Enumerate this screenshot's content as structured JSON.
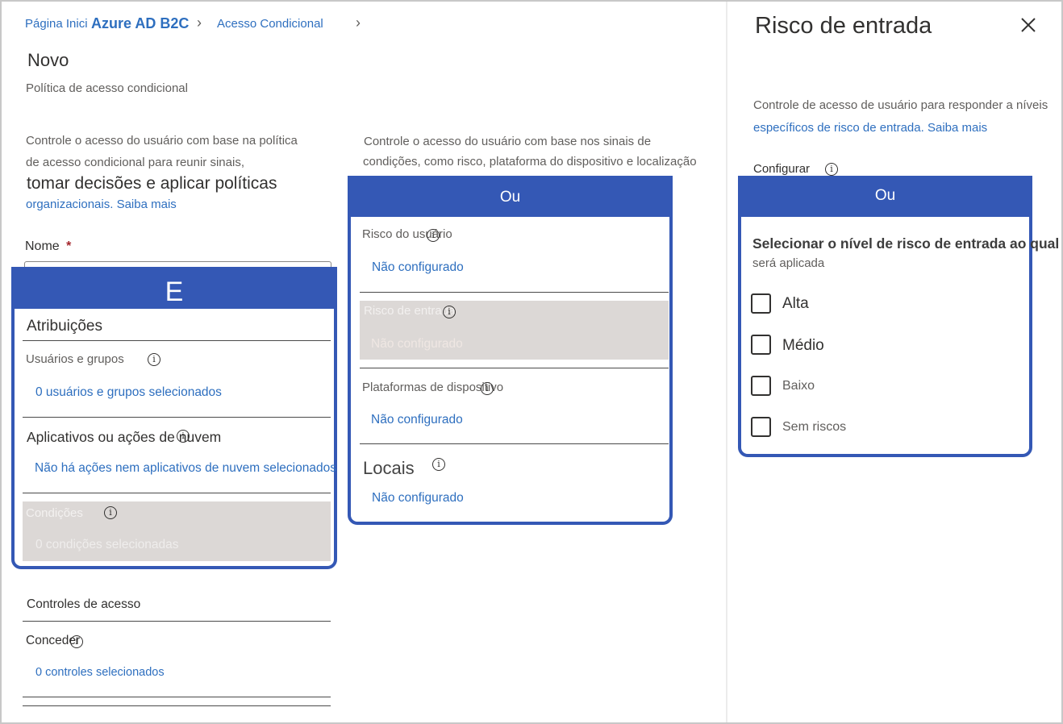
{
  "breadcrumb": {
    "home": "Página Inici",
    "service": "Azure AD B2C",
    "section": "Acesso Condicional"
  },
  "page": {
    "title": "Novo",
    "subtitle": "Política de acesso condicional"
  },
  "intro": {
    "line1": "Controle o acesso do usuário com base na política",
    "line2": "de acesso condicional para reunir sinais,",
    "line3": "tomar decisões e aplicar políticas",
    "line4": "organizacionais.",
    "learn_more": "Saiba mais"
  },
  "name_field": {
    "label": "Nome",
    "required_mark": "*"
  },
  "and_box": {
    "header": "E",
    "assignments_heading": "Atribuições",
    "users_label": "Usuários e grupos",
    "users_value": "0 usuários e grupos selecionados",
    "apps_label": "Aplicativos ou ações de nuvem",
    "apps_value": "Não há ações nem aplicativos de nuvem selecionados",
    "conditions_label": "Condições",
    "conditions_value": "0 condições selecionadas"
  },
  "access_controls": {
    "heading": "Controles de acesso",
    "grant_label": "Conceder",
    "grant_value": "0 controles selecionados"
  },
  "conditions_panel": {
    "intro_line1": "Controle o acesso do usuário com base nos sinais de",
    "intro_line2": "condições, como risco, plataforma do dispositivo e localização",
    "header": "Ou",
    "user_risk_label": "Risco do usuário",
    "user_risk_value": "Não configurado",
    "signin_risk_label": "Risco de entrada",
    "signin_risk_value": "Não configurado",
    "platforms_label": "Plataformas de dispositivo",
    "platforms_value": "Não configurado",
    "locations_label": "Locais",
    "locations_value": "Não configurado"
  },
  "right_panel": {
    "title": "Risco de entrada",
    "desc_line1": "Controle de acesso de usuário para responder a níveis",
    "desc_line2": "específicos de risco de entrada.",
    "learn_more": "Saiba mais",
    "configure_label": "Configurar",
    "header": "Ou",
    "select_line1": "Selecionar o nível de risco de entrada ao qual",
    "select_line2": "será aplicada",
    "options": [
      {
        "label": "Alta",
        "checked": false
      },
      {
        "label": "Médio",
        "checked": false
      },
      {
        "label": "Baixo",
        "checked": false
      },
      {
        "label": "Sem riscos",
        "checked": false
      }
    ]
  },
  "icons": {
    "info": "info-icon",
    "close": "close-icon",
    "breadcrumb_separator": "chevron-right-icon"
  },
  "colors": {
    "accent_blue": "#3458b5",
    "link_blue": "#2e6fbf",
    "shade": "#dcd8d6"
  }
}
